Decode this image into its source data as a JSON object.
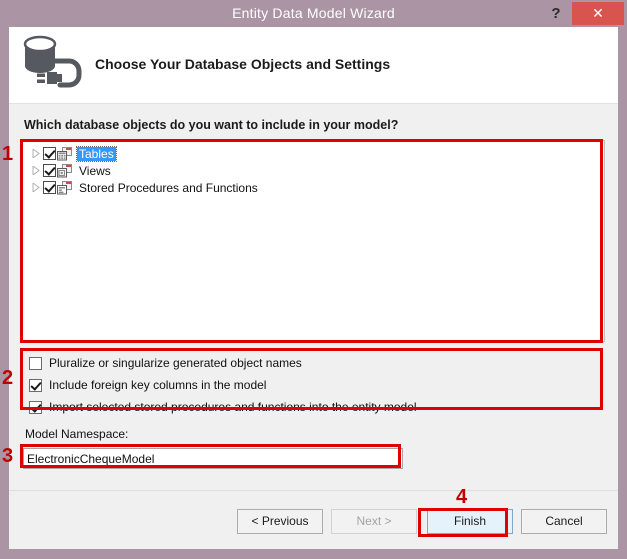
{
  "window": {
    "title": "Entity Data Model Wizard",
    "help_label": "?",
    "close_label": "✕"
  },
  "header": {
    "title": "Choose Your Database Objects and Settings",
    "icon": "database-plug-icon"
  },
  "main": {
    "prompt": "Which database objects do you want to include in your model?",
    "tree": {
      "items": [
        {
          "label": "Tables",
          "checked": true,
          "selected": true,
          "icon": "table-objects-icon"
        },
        {
          "label": "Views",
          "checked": true,
          "selected": false,
          "icon": "view-objects-icon"
        },
        {
          "label": "Stored Procedures and Functions",
          "checked": true,
          "selected": false,
          "icon": "sproc-objects-icon"
        }
      ]
    },
    "options": [
      {
        "label": "Pluralize or singularize generated object names",
        "checked": false
      },
      {
        "label": "Include foreign key columns in the model",
        "checked": true
      },
      {
        "label": "Import selected stored procedures and functions into the entity model",
        "checked": true
      }
    ],
    "namespace": {
      "label": "Model Namespace:",
      "value": "ElectronicChequeModel",
      "placeholder": ""
    }
  },
  "footer": {
    "previous_label": "< Previous",
    "next_label": "Next >",
    "finish_label": "Finish",
    "cancel_label": "Cancel"
  },
  "annotations": {
    "one": "1",
    "two": "2",
    "three": "3",
    "four": "4",
    "color": "#e00000"
  },
  "colors": {
    "titlebar": "#ab94a3",
    "close_button": "#d9534f",
    "body": "#f0f0f0",
    "selection": "#3399ff",
    "default_button": "#e6f2fb"
  }
}
